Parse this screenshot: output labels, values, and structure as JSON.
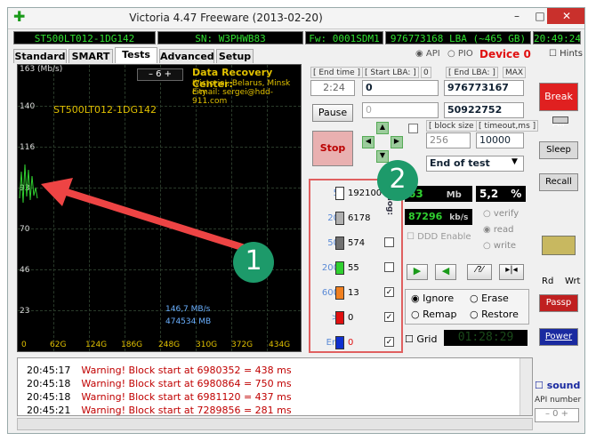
{
  "window": {
    "title": "Victoria 4.47  Freeware (2013-02-20)",
    "min": "–",
    "max": "□",
    "close": "✕"
  },
  "info": {
    "model": "ST500LT012-1DG142",
    "sn": "SN: W3PHWB83",
    "fw": "Fw: 0001SDM1",
    "lba": "976773168 LBA (~465 GB)",
    "time": "20:49:24",
    "api": "API",
    "pio": "PIO",
    "device": "Device 0",
    "hints": "Hints"
  },
  "tabs": [
    "Standard",
    "SMART",
    "Tests",
    "Advanced",
    "Setup"
  ],
  "graph": {
    "ymax": "163 (Mb/s)",
    "ylabels": [
      "140",
      "116",
      "93",
      "70",
      "46",
      "23"
    ],
    "xlabels": [
      "0",
      "62G",
      "124G",
      "186G",
      "248G",
      "310G",
      "372G",
      "434G"
    ],
    "model_label": "ST500LT012-1DG142",
    "spin_value": "6",
    "promo": [
      "Data Recovery Center:",
      "'Victoria', Belarus, Minsk city",
      "E-mail: sergei@hdd-911.com"
    ],
    "speed": "146,7 MB/s",
    "mb": "474534 MB"
  },
  "controls": {
    "end_time_label": "[ End time ]",
    "start_lba_label": "[ Start LBA: ]",
    "start_lba_small": "0",
    "end_lba_label": "[ End LBA: ]",
    "max_label": "MAX",
    "end_time": "2:24",
    "start_lba": "0",
    "end_lba": "976773167",
    "cur_lba": "50922752",
    "zero_field": "0",
    "pause": "Pause",
    "stop": "Stop",
    "block_size_label": "[ block size ]",
    "timeout_label": "[ timeout,ms ]",
    "block_size": "256",
    "timeout": "10000",
    "mode": "End of test"
  },
  "blocks": [
    {
      "n": "5",
      "c": "192100",
      "color": "#ffffff"
    },
    {
      "n": "20",
      "c": "6178",
      "color": "#b0b0b0"
    },
    {
      "n": "50",
      "c": "574",
      "color": "#707070"
    },
    {
      "n": "200",
      "c": "55",
      "color": "#30d030"
    },
    {
      "n": "600",
      "c": "13",
      "color": "#f08020"
    },
    {
      "n": ">",
      "c": "0",
      "color": "#e01010"
    },
    {
      "n": "Err",
      "c": "0",
      "color": "#1030d0"
    }
  ],
  "blocks_side": "do log:",
  "stats": {
    "mb": "63",
    "mb_unit": "Mb",
    "pct": "5,2",
    "pct_unit": "%",
    "speed": "87296",
    "speed_unit": "kb/s",
    "verify": "verify",
    "read": "read",
    "write": "write",
    "ddd": "DDD Enable"
  },
  "actions": {
    "ignore": "Ignore",
    "erase": "Erase",
    "remap": "Remap",
    "restore": "Restore",
    "grid": "Grid",
    "timer": "01:28:29"
  },
  "right": {
    "break_all": "Break All",
    "sleep": "Sleep",
    "recall": "Recall",
    "rd": "Rd",
    "wrt": "Wrt",
    "passp": "Passp",
    "power": "Power",
    "sound": "sound",
    "api_number": "API number",
    "api_value": "0"
  },
  "log": [
    {
      "t": "20:45:17",
      "m": "Warning! Block start at 6980352 = 438 ms"
    },
    {
      "t": "20:45:18",
      "m": "Warning! Block start at 6980864 = 750 ms"
    },
    {
      "t": "20:45:18",
      "m": "Warning! Block start at 6981120 = 437 ms"
    },
    {
      "t": "20:45:21",
      "m": "Warning! Block start at 7289856 = 281 ms"
    }
  ],
  "annotations": [
    "1",
    "2"
  ]
}
